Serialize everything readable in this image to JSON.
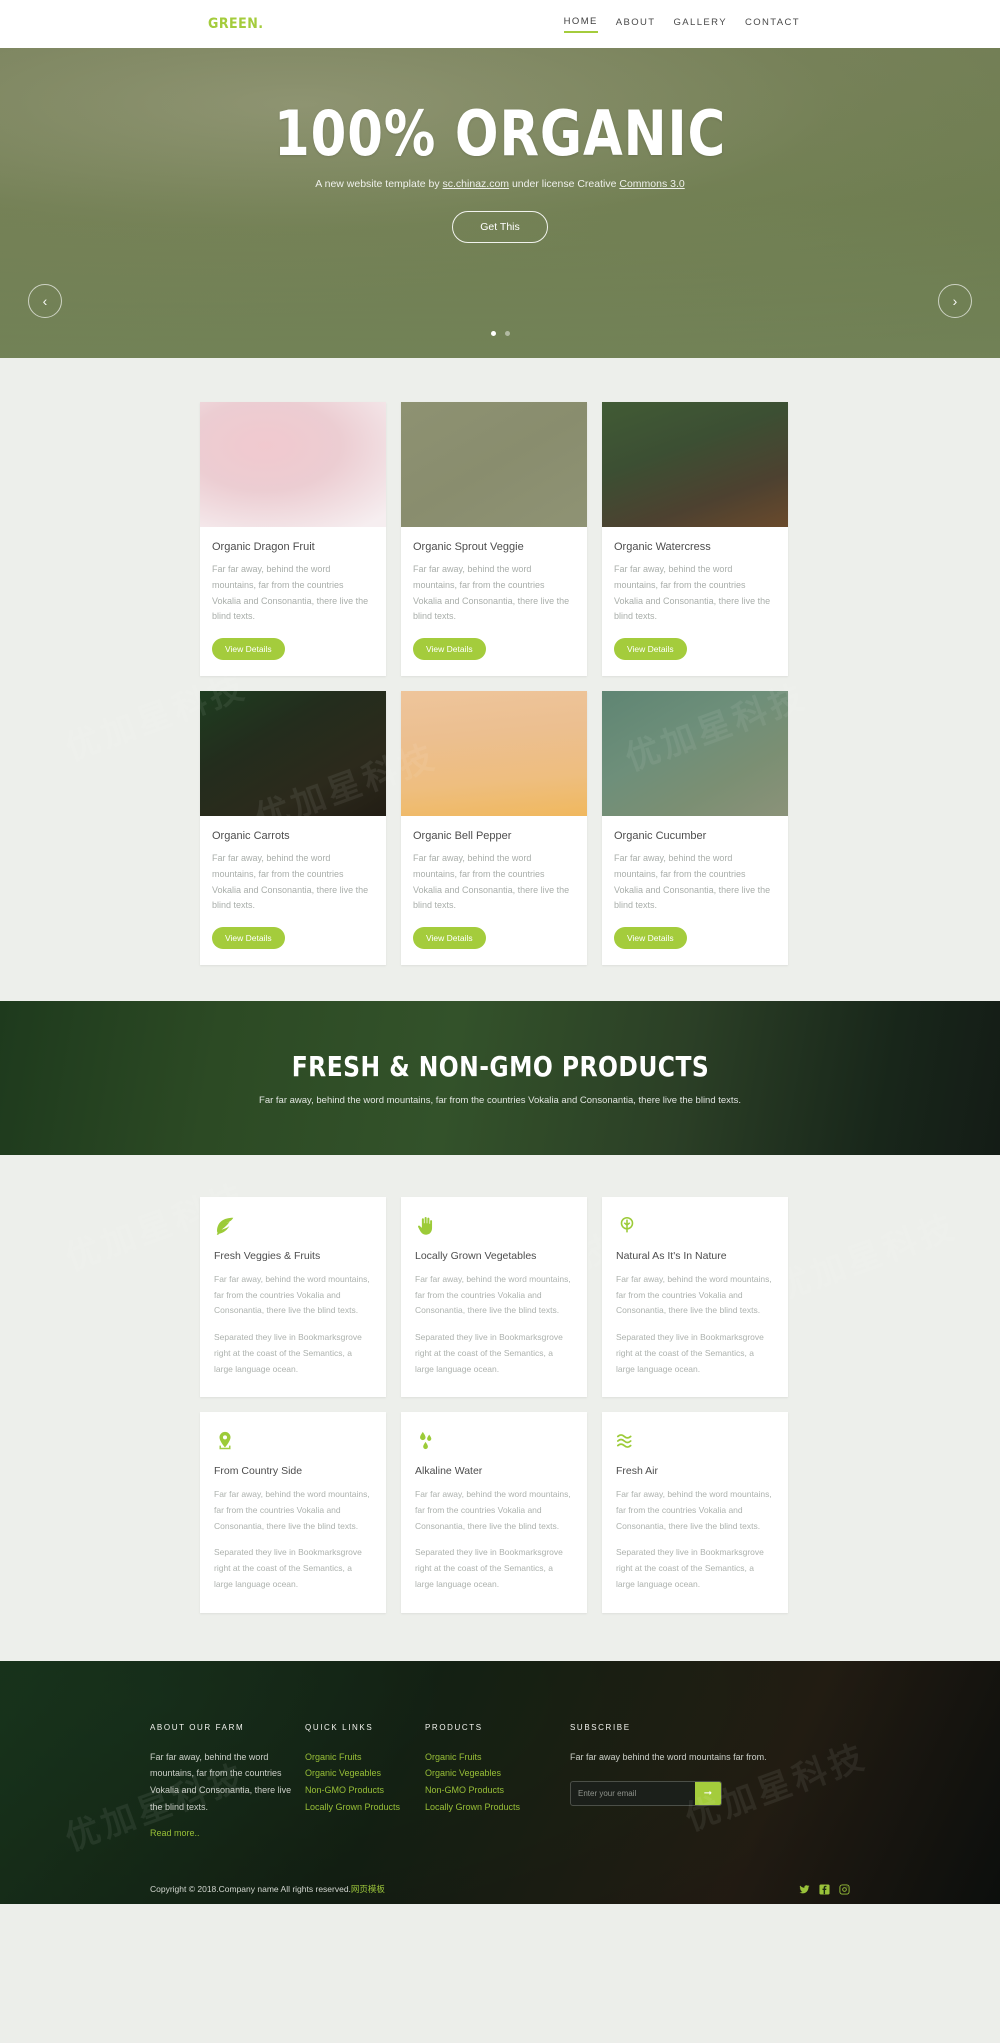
{
  "header": {
    "logo": "GREEN.",
    "nav": [
      {
        "label": "HOME",
        "active": true
      },
      {
        "label": "ABOUT",
        "active": false
      },
      {
        "label": "GALLERY",
        "active": false
      },
      {
        "label": "CONTACT",
        "active": false
      }
    ]
  },
  "hero": {
    "title": "100% ORGANIC",
    "subtitle_prefix": "A new website template by ",
    "subtitle_link": "sc.chinaz.com",
    "subtitle_mid": " under license Creative ",
    "subtitle_link2": "Commons 3.0",
    "button": "Get This",
    "prev_icon": "chevron-left-icon",
    "next_icon": "chevron-right-icon",
    "dots": 2,
    "active_dot": 0
  },
  "products": {
    "button_label": "View Details",
    "items": [
      {
        "title": "Organic Dragon Fruit",
        "text": "Far far away, behind the word mountains, far from the countries Vokalia and Consonantia, there live the blind texts."
      },
      {
        "title": "Organic Sprout Veggie",
        "text": "Far far away, behind the word mountains, far from the countries Vokalia and Consonantia, there live the blind texts."
      },
      {
        "title": "Organic Watercress",
        "text": "Far far away, behind the word mountains, far from the countries Vokalia and Consonantia, there live the blind texts."
      },
      {
        "title": "Organic Carrots",
        "text": "Far far away, behind the word mountains, far from the countries Vokalia and Consonantia, there live the blind texts."
      },
      {
        "title": "Organic Bell Pepper",
        "text": "Far far away, behind the word mountains, far from the countries Vokalia and Consonantia, there live the blind texts."
      },
      {
        "title": "Organic Cucumber",
        "text": "Far far away, behind the word mountains, far from the countries Vokalia and Consonantia, there live the blind texts."
      }
    ]
  },
  "banner": {
    "title": "FRESH & NON-GMO PRODUCTS",
    "subtitle": "Far far away, behind the word mountains, far from the countries Vokalia and Consonantia, there live the blind texts."
  },
  "features": {
    "items": [
      {
        "icon": "leaf-icon",
        "title": "Fresh Veggies & Fruits",
        "text1": "Far far away, behind the word mountains, far from the countries Vokalia and Consonantia, there live the blind texts.",
        "text2": "Separated they live in Bookmarksgrove right at the coast of the Semantics, a large language ocean."
      },
      {
        "icon": "hand-icon",
        "title": "Locally Grown Vegetables",
        "text1": "Far far away, behind the word mountains, far from the countries Vokalia and Consonantia, there live the blind texts.",
        "text2": "Separated they live in Bookmarksgrove right at the coast of the Semantics, a large language ocean."
      },
      {
        "icon": "tree-icon",
        "title": "Natural As It's In Nature",
        "text1": "Far far away, behind the word mountains, far from the countries Vokalia and Consonantia, there live the blind texts.",
        "text2": "Separated they live in Bookmarksgrove right at the coast of the Semantics, a large language ocean."
      },
      {
        "icon": "location-pin-icon",
        "title": "From Country Side",
        "text1": "Far far away, behind the word mountains, far from the countries Vokalia and Consonantia, there live the blind texts.",
        "text2": "Separated they live in Bookmarksgrove right at the coast of the Semantics, a large language ocean."
      },
      {
        "icon": "water-drop-icon",
        "title": "Alkaline Water",
        "text1": "Far far away, behind the word mountains, far from the countries Vokalia and Consonantia, there live the blind texts.",
        "text2": "Separated they live in Bookmarksgrove right at the coast of the Semantics, a large language ocean."
      },
      {
        "icon": "wave-icon",
        "title": "Fresh Air",
        "text1": "Far far away, behind the word mountains, far from the countries Vokalia and Consonantia, there live the blind texts.",
        "text2": "Separated they live in Bookmarksgrove right at the coast of the Semantics, a large language ocean."
      }
    ]
  },
  "footer": {
    "about": {
      "heading": "ABOUT OUR FARM",
      "text": "Far far away, behind the word mountains, far from the countries Vokalia and Consonantia, there live the blind texts.",
      "read_more": "Read more.."
    },
    "quick_links": {
      "heading": "QUICK LINKS",
      "items": [
        "Organic Fruits",
        "Organic Vegeables",
        "Non-GMO Products",
        "Locally Grown Products"
      ]
    },
    "products": {
      "heading": "PRODUCTS",
      "items": [
        "Organic Fruits",
        "Organic Vegeables",
        "Non-GMO Products",
        "Locally Grown Products"
      ]
    },
    "subscribe": {
      "heading": "SUBSCRIBE",
      "text": "Far far away behind the word mountains far from.",
      "placeholder": "Enter your email",
      "submit_icon": "arrow-right-icon"
    },
    "copyright_text": "Copyright © 2018.Company name All rights reserved.",
    "copyright_link": "网页模板",
    "socials": [
      {
        "name": "twitter-icon"
      },
      {
        "name": "facebook-icon"
      },
      {
        "name": "instagram-icon"
      }
    ]
  },
  "colors": {
    "accent": "#a4cc3c",
    "page_bg": "#edefeb",
    "footer_bg": "#13291a"
  },
  "watermarks": [
    "优加星科技",
    "优加星科技",
    "优加星科技",
    "优加星科技",
    "优加星科技",
    "优加星科技",
    "优加星科技",
    "优加星科技"
  ]
}
